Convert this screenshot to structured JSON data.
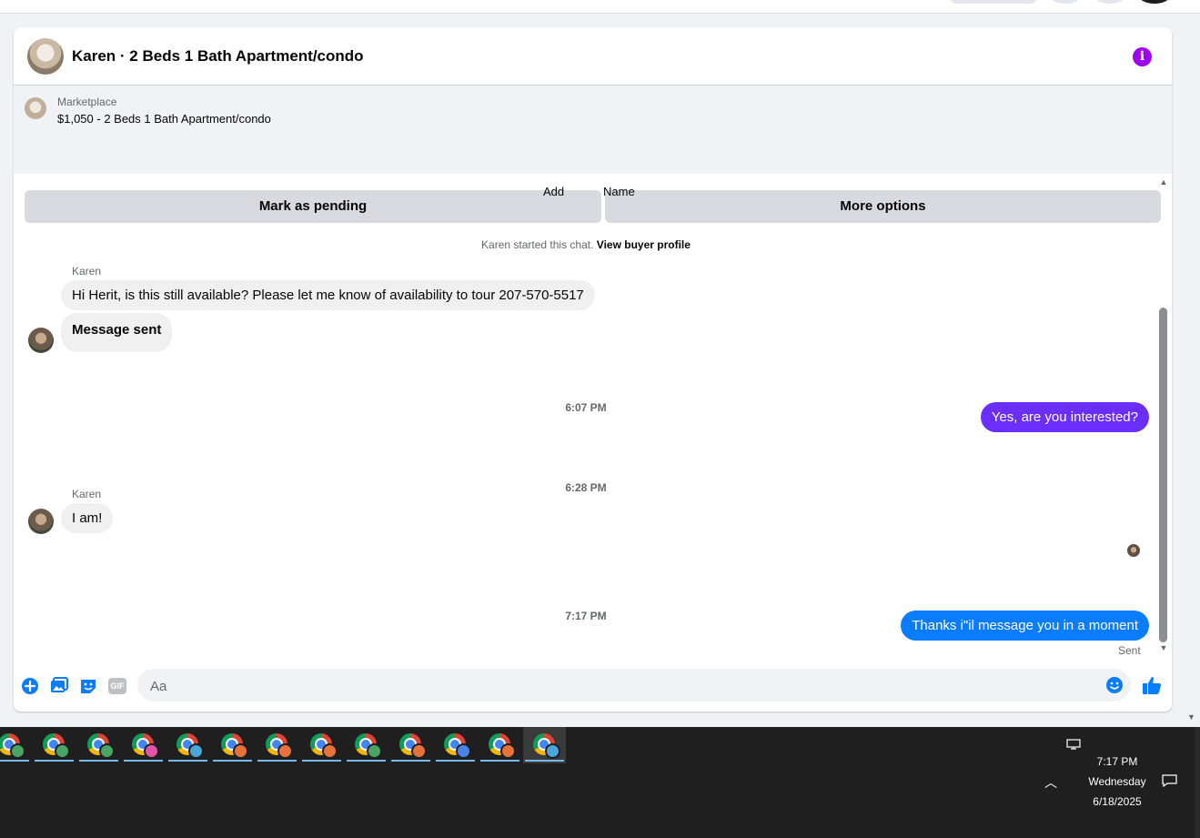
{
  "chat": {
    "title": "Karen · 2 Beds 1 Bath Apartment/condo",
    "info_icon": "info-icon"
  },
  "listing": {
    "source": "Marketplace",
    "title": "$1,050 - 2 Beds 1 Bath Apartment/condo",
    "buttons": {
      "pending": "Mark as pending",
      "more": "More options"
    }
  },
  "thread": {
    "add_label": "Add",
    "name_label": "Name",
    "started_prefix": "Karen started this chat.",
    "started_link": "View buyer profile",
    "messages": [
      {
        "sender": "Karen",
        "text": "Hi Herit, is this still available? Please let me know of availability to tour 207-570-5517"
      },
      {
        "sender": "Karen",
        "text": "Message sent"
      },
      {
        "timestamp": "6:07 PM"
      },
      {
        "sender": "me",
        "text": "Yes, are you interested?"
      },
      {
        "timestamp": "6:28 PM"
      },
      {
        "sender": "Karen",
        "text": "I am!"
      },
      {
        "timestamp": "7:17 PM"
      },
      {
        "sender": "me",
        "text": "Thanks i\"il message you in a moment"
      }
    ],
    "status": "Sent"
  },
  "composer": {
    "placeholder": "Aa",
    "icons": [
      "plus-icon",
      "photo-icon",
      "sticker-icon",
      "gif-icon",
      "emoji-icon",
      "thumbs-up-icon"
    ],
    "gif_label": "GIF"
  },
  "taskbar": {
    "time": "7:17 PM",
    "day": "Wednesday",
    "date": "6/18/2025",
    "app_count": 13
  },
  "colors": {
    "outgoing_blue": "#0a7cff",
    "outgoing_purple": "#6a2fff",
    "incoming_gray": "#f0f0f0",
    "info_purple": "#a000f0",
    "messenger_blue": "#0a7cff"
  }
}
